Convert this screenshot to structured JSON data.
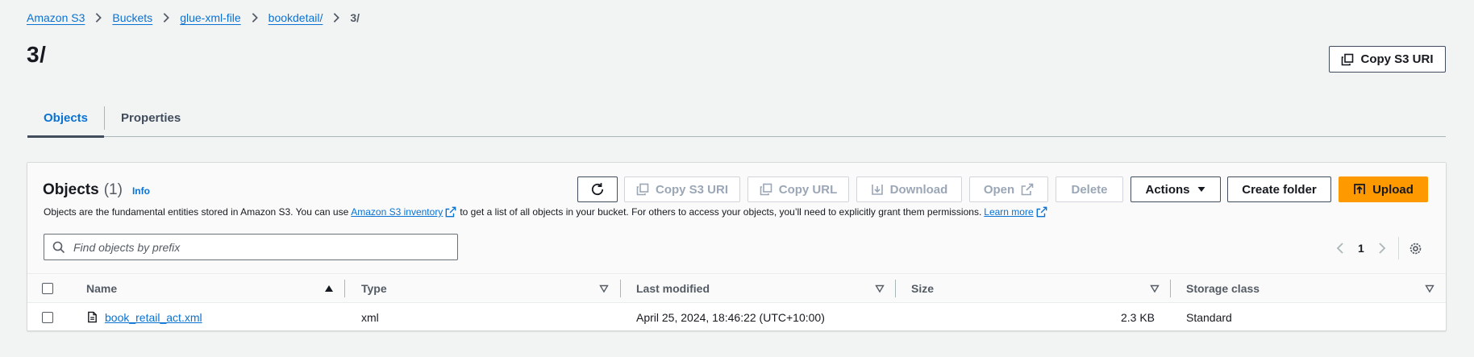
{
  "breadcrumb": {
    "items": [
      "Amazon S3",
      "Buckets",
      "glue-xml-file",
      "bookdetail/"
    ],
    "current": "3/"
  },
  "page": {
    "title": "3/",
    "copy_uri_label": "Copy S3 URI"
  },
  "tabs": [
    {
      "label": "Objects",
      "active": true
    },
    {
      "label": "Properties",
      "active": false
    }
  ],
  "objects_panel": {
    "title": "Objects",
    "count": "(1)",
    "info_label": "Info",
    "description_before": "Objects are the fundamental entities stored in Amazon S3. You can use",
    "inventory_link": "Amazon S3 inventory",
    "description_middle": "to get a list of all objects in your bucket. For others to access your objects, you’ll need to explicitly grant them permissions.",
    "learn_more": "Learn more"
  },
  "toolbar": {
    "copy_s3_uri": "Copy S3 URI",
    "copy_url": "Copy URL",
    "download": "Download",
    "open": "Open",
    "delete": "Delete",
    "actions": "Actions",
    "create_folder": "Create folder",
    "upload": "Upload"
  },
  "search": {
    "placeholder": "Find objects by prefix",
    "value": ""
  },
  "pagination": {
    "current_page": "1"
  },
  "table": {
    "columns": [
      "Name",
      "Type",
      "Last modified",
      "Size",
      "Storage class"
    ],
    "rows": [
      {
        "name": "book_retail_act.xml",
        "type": "xml",
        "last_modified": "April 25, 2024, 18:46:22 (UTC+10:00)",
        "size": "2.3 KB",
        "storage_class": "Standard"
      }
    ]
  },
  "colors": {
    "link": "#0972d3",
    "primary": "#ff9900",
    "background": "#f2f3f3"
  }
}
